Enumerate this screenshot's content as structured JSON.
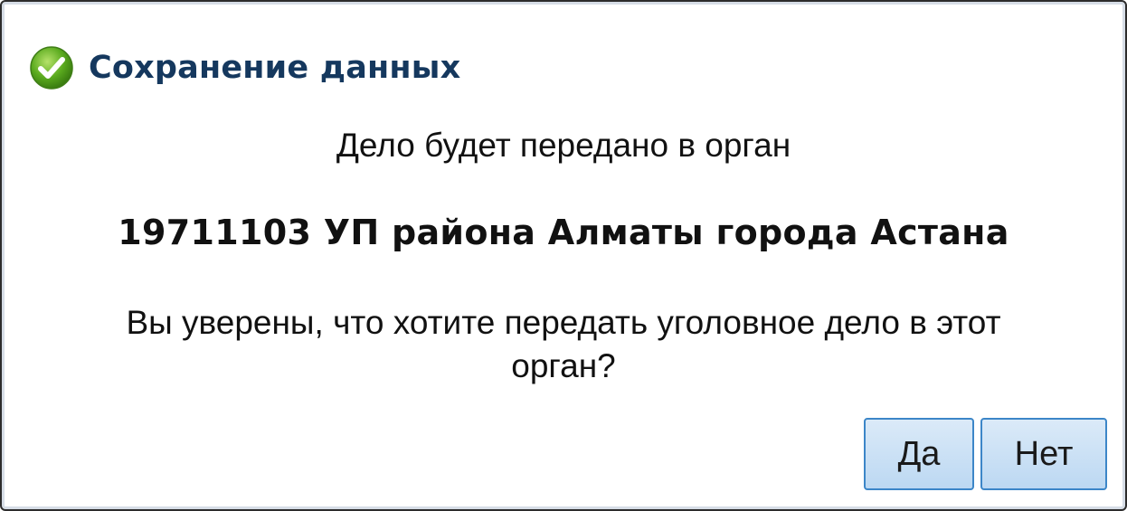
{
  "dialog": {
    "title": "Сохранение данных",
    "title_icon": "check-circle-icon",
    "message_line1": "Дело будет передано в орган",
    "organ_name": "19711103 УП района Алматы города Астана",
    "question": "Вы уверены, что хотите передать уголовное дело в этот орган?"
  },
  "buttons": {
    "yes_label": "Да",
    "no_label": "Нет"
  },
  "colors": {
    "title": "#15385e",
    "icon_green": "#5aaa1e",
    "button_border": "#3c86c8",
    "button_fill": "#c8e0f5"
  }
}
